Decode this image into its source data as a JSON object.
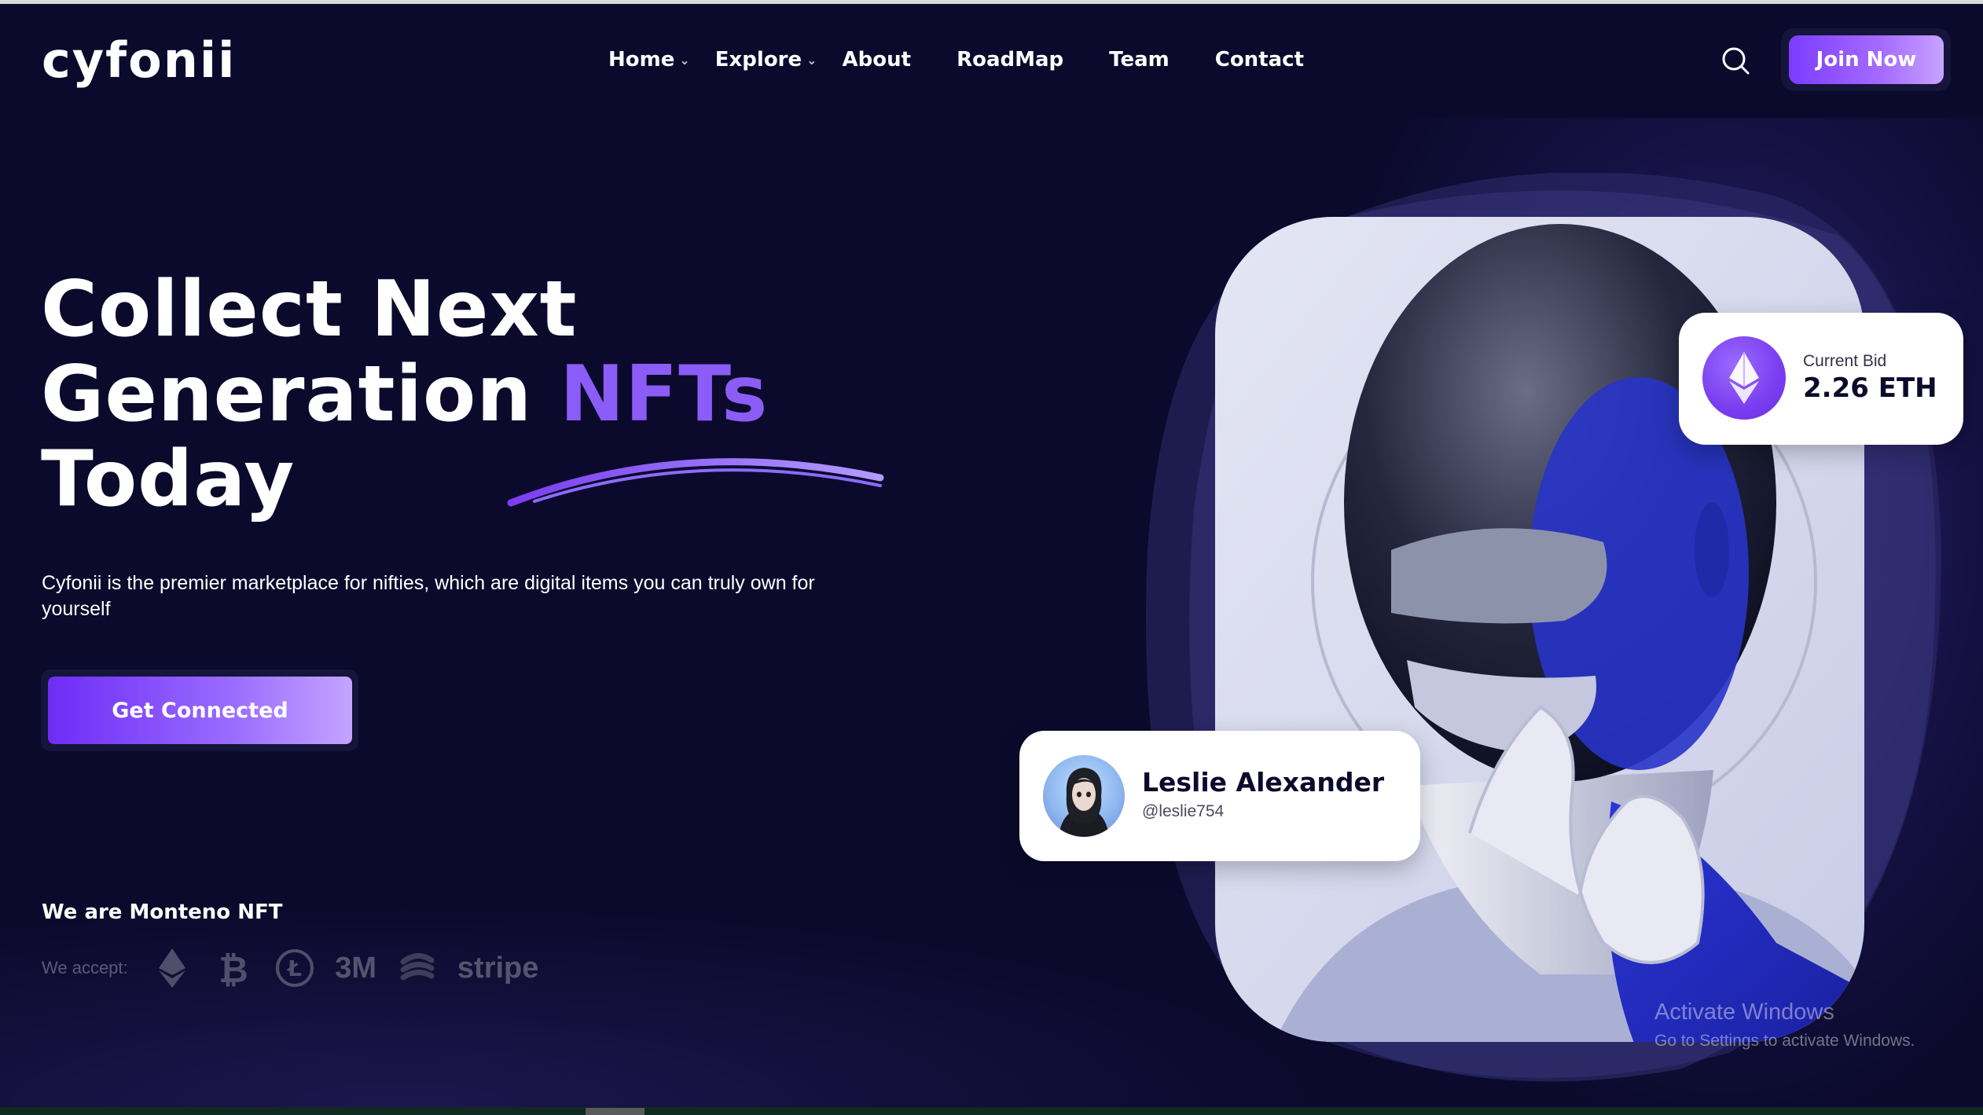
{
  "header": {
    "logo": "cyfonii",
    "nav": [
      {
        "label": "Home",
        "has_dropdown": true
      },
      {
        "label": "Explore",
        "has_dropdown": true
      },
      {
        "label": "About",
        "has_dropdown": false
      },
      {
        "label": "RoadMap",
        "has_dropdown": false
      },
      {
        "label": "Team",
        "has_dropdown": false
      },
      {
        "label": "Contact",
        "has_dropdown": false
      }
    ],
    "search_icon": "search-icon",
    "join_label": "Join Now"
  },
  "hero": {
    "line1": "Collect Next",
    "line2_start": "Generation",
    "line2_accent": "NFTs",
    "line3": "Today",
    "description": "Cyfonii is the premier marketplace for nifties, which are digital items you can truly own for yourself",
    "cta_label": "Get Connected",
    "we_are": "We are Monteno NFT",
    "accept_label": "We accept:",
    "payment_icons": [
      "ethereum-icon",
      "bitcoin-icon",
      "litecoin-icon",
      "3m-logo",
      "swirl-logo",
      "stripe-logo"
    ],
    "payment_texts": {
      "three_m": "3M",
      "stripe": "stripe"
    }
  },
  "bid_card": {
    "label": "Current Bid",
    "value": "2.26 ETH",
    "icon": "ethereum-icon"
  },
  "user_card": {
    "name": "Leslie Alexander",
    "handle": "@leslie754"
  },
  "overlay": {
    "activate_title": "Activate Windows",
    "activate_sub": "Go to Settings to activate Windows."
  },
  "colors": {
    "background": "#0b0a2c",
    "accent": "#8b5cf6",
    "button_gradient_start": "#6d2cf5",
    "button_gradient_end": "#c4a4ff"
  }
}
